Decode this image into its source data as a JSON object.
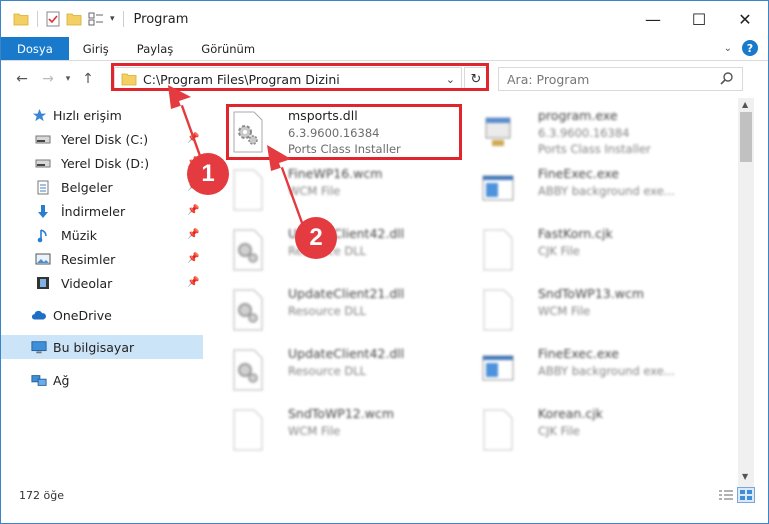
{
  "window": {
    "title": "Program",
    "controls": {
      "minimize": "—",
      "maximize": "☐",
      "close": "✕"
    }
  },
  "ribbon": {
    "tabs": [
      "Dosya",
      "Giriş",
      "Paylaş",
      "Görünüm"
    ]
  },
  "address": {
    "path": "C:\\Program Files\\Program Dizini",
    "search_placeholder": "Ara: Program"
  },
  "sidebar": {
    "quick_access": "Hızlı erişim",
    "items": [
      {
        "label": "Yerel Disk (C:)",
        "icon": "drive-icon"
      },
      {
        "label": "Yerel Disk (D:)",
        "icon": "drive-icon"
      },
      {
        "label": "Belgeler",
        "icon": "documents-icon"
      },
      {
        "label": "İndirmeler",
        "icon": "download-icon"
      },
      {
        "label": "Müzik",
        "icon": "music-icon"
      },
      {
        "label": "Resimler",
        "icon": "pictures-icon"
      },
      {
        "label": "Videolar",
        "icon": "videos-icon"
      }
    ],
    "onedrive": "OneDrive",
    "this_pc": "Bu bilgisayar",
    "network": "Ağ"
  },
  "files": [
    {
      "name": "msports.dll",
      "line1": "6.3.9600.16384",
      "line2": "Ports Class Installer",
      "icon": "dll"
    },
    {
      "name": "program.exe",
      "line1": "6.3.9600.16384",
      "line2": "Ports Class Installer",
      "icon": "exe"
    },
    {
      "name": "FineWP16.wcm",
      "line1": "WCM File",
      "line2": "",
      "icon": "blank"
    },
    {
      "name": "FineExec.exe",
      "line1": "ABBY background exe...",
      "line2": "",
      "icon": "app"
    },
    {
      "name": "UpdateClient42.dll",
      "line1": "Resource DLL",
      "line2": "",
      "icon": "dll"
    },
    {
      "name": "FastKorn.cjk",
      "line1": "CJK File",
      "line2": "",
      "icon": "blank"
    },
    {
      "name": "UpdateClient21.dll",
      "line1": "Resource DLL",
      "line2": "",
      "icon": "dll"
    },
    {
      "name": "SndToWP13.wcm",
      "line1": "WCM File",
      "line2": "",
      "icon": "blank"
    },
    {
      "name": "UpdateClient42.dll",
      "line1": "Resource DLL",
      "line2": "",
      "icon": "dll"
    },
    {
      "name": "FineExec.exe",
      "line1": "ABBY background exe...",
      "line2": "",
      "icon": "app"
    },
    {
      "name": "SndToWP12.wcm",
      "line1": "WCM File",
      "line2": "",
      "icon": "blank"
    },
    {
      "name": "Korean.cjk",
      "line1": "CJK File",
      "line2": "",
      "icon": "blank"
    }
  ],
  "status": {
    "count": "172 öğe"
  },
  "annotations": {
    "badge1": "1",
    "badge2": "2"
  },
  "colors": {
    "accent": "#1979ca",
    "highlight": "#e0262c",
    "selection": "#cce4f7"
  }
}
